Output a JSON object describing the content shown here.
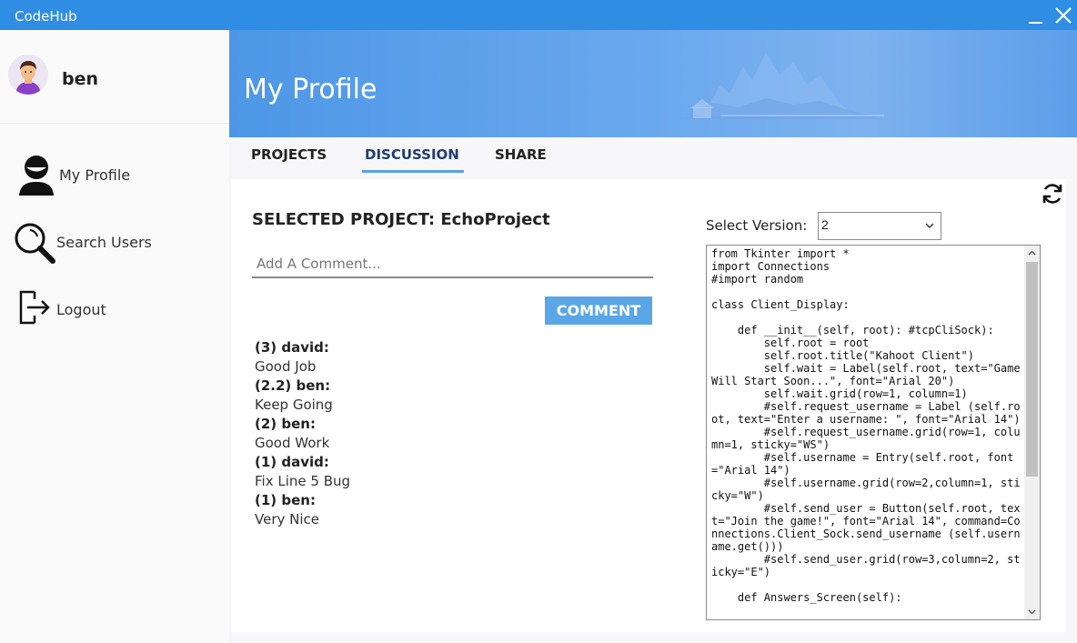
{
  "app": {
    "title": "CodeHub"
  },
  "window_controls": {
    "minimize_icon": "minimize-icon",
    "close_icon": "close-icon"
  },
  "sidebar": {
    "username": "ben",
    "items": [
      {
        "label": "My Profile",
        "icon": "user-icon"
      },
      {
        "label": "Search Users",
        "icon": "search-icon"
      },
      {
        "label": "Logout",
        "icon": "logout-icon"
      }
    ]
  },
  "header": {
    "title": "My Profile"
  },
  "tabs": [
    {
      "label": "PROJECTS",
      "active": false
    },
    {
      "label": "DISCUSSION",
      "active": true
    },
    {
      "label": "SHARE",
      "active": false
    }
  ],
  "discussion": {
    "selected_project": "SELECTED PROJECT: EchoProject",
    "comment_placeholder": "Add A Comment...",
    "comment_button": "COMMENT",
    "comments": [
      {
        "author": "(3) david:",
        "text": "Good Job"
      },
      {
        "author": "(2.2) ben:",
        "text": "Keep Going"
      },
      {
        "author": "(2) ben:",
        "text": "Good Work"
      },
      {
        "author": "(1) david:",
        "text": "Fix Line 5 Bug"
      },
      {
        "author": "(1) ben:",
        "text": "Very Nice"
      }
    ]
  },
  "version": {
    "label": "Select Version:",
    "selected": "2"
  },
  "code": "from Tkinter import *\nimport Connections\n#import random\n\nclass Client_Display:\n\n    def __init__(self, root): #tcpCliSock):\n        self.root = root\n        self.root.title(\"Kahoot Client\")\n        self.wait = Label(self.root, text=\"Game Will Start Soon...\", font=\"Arial 20\")\n        self.wait.grid(row=1, column=1)\n        #self.request_username = Label (self.root, text=\"Enter a username: \", font=\"Arial 14\")\n        #self.request_username.grid(row=1, column=1, sticky=\"WS\")\n        #self.username = Entry(self.root, font=\"Arial 14\")\n        #self.username.grid(row=2,column=1, sticky=\"W\")\n        #self.send_user = Button(self.root, text=\"Join the game!\", font=\"Arial 14\", command=Connections.Client_Sock.send_username (self.username.get()))\n        #self.send_user.grid(row=3,column=2, sticky=\"E\")\n\n    def Answers_Screen(self):",
  "colors": {
    "titlebar": "#2f8de3",
    "accent": "#5aa6e6",
    "tab_underline": "#5aa0e8"
  }
}
